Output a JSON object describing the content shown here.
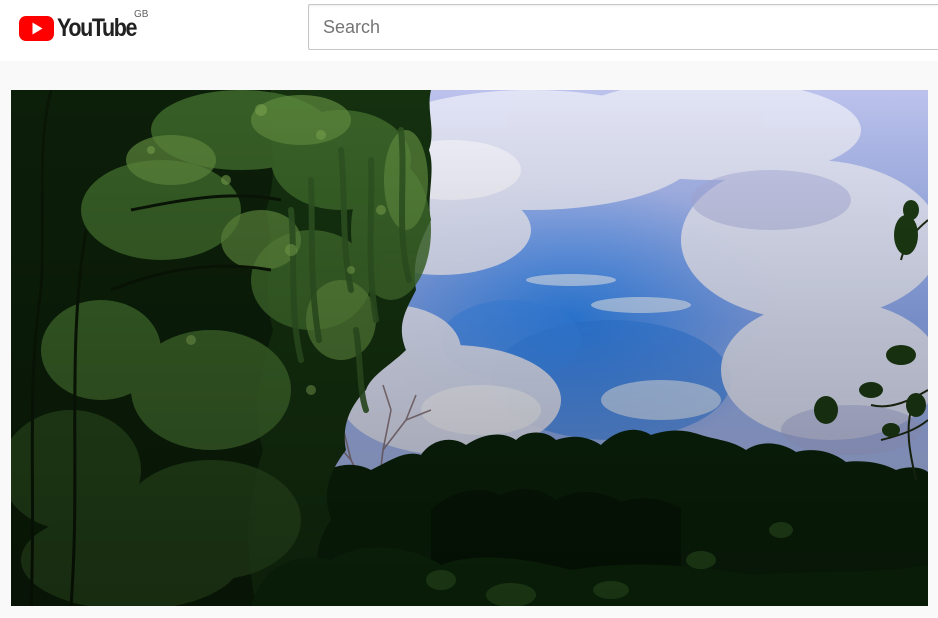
{
  "masthead": {
    "logo_text": "YouTube",
    "country_code": "GB",
    "logo_icon": "youtube-play-icon",
    "brand_color": "#ff0000"
  },
  "search": {
    "placeholder": "Search",
    "value": ""
  },
  "player": {
    "content": "video-frame"
  }
}
